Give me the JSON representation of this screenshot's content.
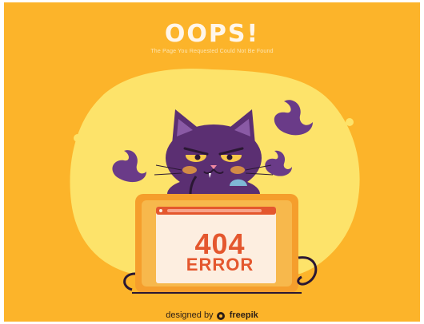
{
  "page": {
    "title": "OOPS!",
    "subtitle": "The Page You Requested Could Not Be Found",
    "error_code": "404",
    "error_word": "ERROR",
    "credit_prefix": "designed by",
    "credit_brand": "freepik"
  },
  "colors": {
    "background": "#fcb42a",
    "blob": "#fde36a",
    "cat": "#5b2f72",
    "laptop": "#f59e2c",
    "screen": "#fdeee0",
    "accent": "#e4572e"
  },
  "icons": {
    "logo": "freepik-logo-icon"
  }
}
